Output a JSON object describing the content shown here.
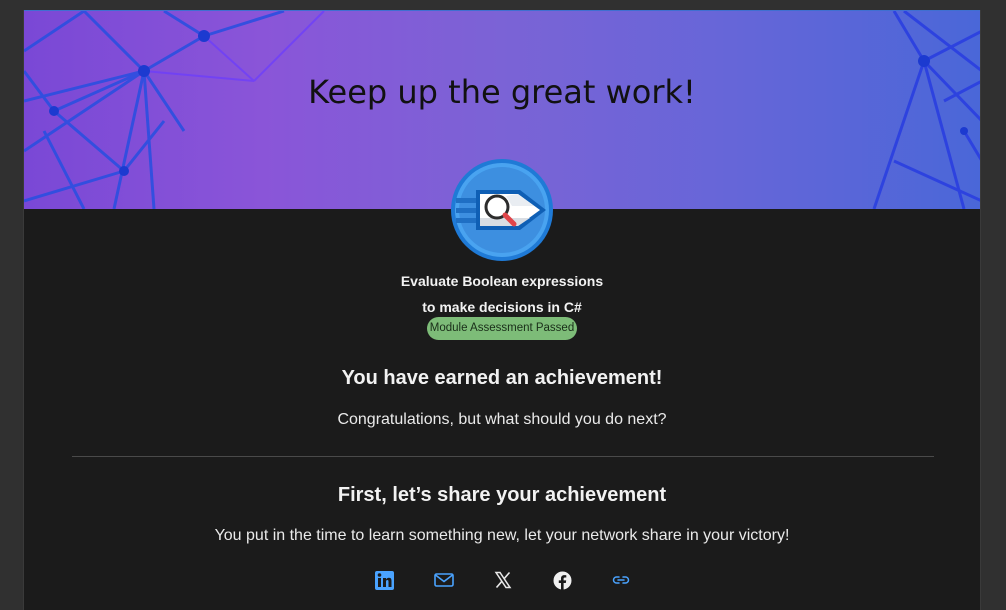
{
  "hero": {
    "title": "Keep up the great work!"
  },
  "module": {
    "title_line1": "Evaluate Boolean expressions",
    "title_line2": "to make decisions in C#",
    "status": "Module Assessment Passed",
    "badge_icon": "magnifier-rocket-icon"
  },
  "achievement": {
    "heading": "You have earned an achievement!",
    "text": "Congratulations, but what should you do next?"
  },
  "share": {
    "heading": "First, let’s share your achievement",
    "text": "You put in the time to learn something new, let your network share in your victory!",
    "buttons": [
      {
        "icon": "linkedin-icon",
        "label": "LinkedIn"
      },
      {
        "icon": "email-icon",
        "label": "Email"
      },
      {
        "icon": "x-icon",
        "label": "X"
      },
      {
        "icon": "facebook-icon",
        "label": "Facebook"
      },
      {
        "icon": "link-icon",
        "label": "Copy link"
      }
    ]
  },
  "colors": {
    "accent_blue": "#4aa3ff",
    "badge_green": "#7dbc78",
    "background": "#1b1b1b"
  }
}
